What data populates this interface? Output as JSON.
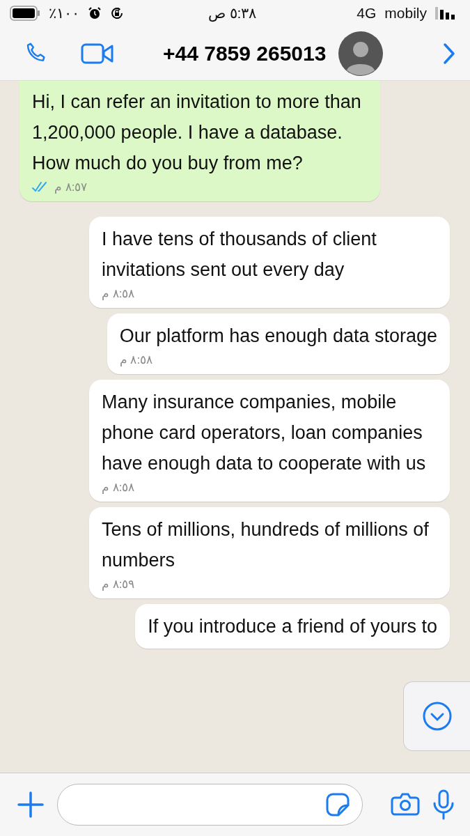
{
  "status_bar": {
    "battery": "٪١٠٠",
    "time": "٥:٣٨ ص",
    "network": "4G",
    "carrier": "mobily"
  },
  "header": {
    "contact": "+44 7859 265013"
  },
  "messages": [
    {
      "kind": "sent",
      "text": "Hi, I can refer an invitation to more than 1,200,000 people. I have a database. How much do you buy from me?",
      "time": "٨:٥٧ م",
      "read": true
    },
    {
      "kind": "received",
      "text": "I have tens of thousands of client invitations sent out every day",
      "time": "٨:٥٨ م"
    },
    {
      "kind": "received",
      "text": "Our platform has enough data storage",
      "time": "٨:٥٨ م"
    },
    {
      "kind": "received",
      "text": "Many insurance companies, mobile phone card operators, loan companies have enough data to cooperate with us",
      "time": "٨:٥٨ م"
    },
    {
      "kind": "received",
      "text": "Tens of millions, hundreds of millions of numbers",
      "time": "٨:٥٩ م"
    },
    {
      "kind": "received",
      "text": "If you introduce a friend of yours to"
    }
  ]
}
